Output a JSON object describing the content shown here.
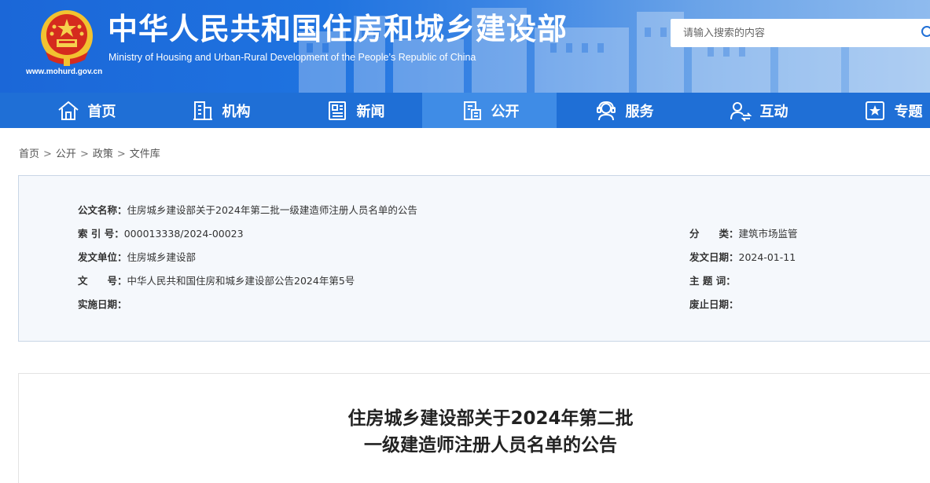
{
  "header": {
    "title": "中华人民共和国住房和城乡建设部",
    "subtitle": "Ministry of Housing and Urban-Rural Development of the People’s Republic of China",
    "url": "www.mohurd.gov.cn",
    "search_placeholder": "请输入搜索的内容",
    "emblem_icon": "national-emblem-icon",
    "search_icon": "search-icon"
  },
  "nav": {
    "active_index": 3,
    "items": [
      {
        "label": "首页",
        "icon": "home-icon"
      },
      {
        "label": "机构",
        "icon": "building-icon"
      },
      {
        "label": "新闻",
        "icon": "news-icon"
      },
      {
        "label": "公开",
        "icon": "document-icon"
      },
      {
        "label": "服务",
        "icon": "service-icon"
      },
      {
        "label": "互动",
        "icon": "interaction-icon"
      },
      {
        "label": "专题",
        "icon": "special-topic-icon"
      }
    ]
  },
  "breadcrumb": {
    "items": [
      "首页",
      "公开",
      "政策",
      "文件库"
    ],
    "separator": ">"
  },
  "info": {
    "doc_name_label": "公文名称：",
    "doc_name": "住房城乡建设部关于2024年第二批一级建造师注册人员名单的公告",
    "index_label": "索 引 号：",
    "index": "000013338/2024-00023",
    "category_label": "分　　类：",
    "category": "建筑市场监管",
    "issuer_label": "发文单位：",
    "issuer": "住房城乡建设部",
    "issue_date_label": "发文日期：",
    "issue_date": "2024-01-11",
    "doc_no_label": "文　　号：",
    "doc_no": "中华人民共和国住房和城乡建设部公告2024年第5号",
    "subject_label": "主 题 词：",
    "subject": "",
    "effective_label": "实施日期：",
    "effective": "",
    "expiry_label": "废止日期：",
    "expiry": ""
  },
  "article": {
    "title_line1": "住房城乡建设部关于2024年第二批",
    "title_line2": "一级建造师注册人员名单的公告"
  },
  "colors": {
    "header_blue": "#1b67d8",
    "nav_blue": "#1f6fd6",
    "nav_active": "#3f8ce6",
    "info_bg": "#f5f8fc"
  }
}
